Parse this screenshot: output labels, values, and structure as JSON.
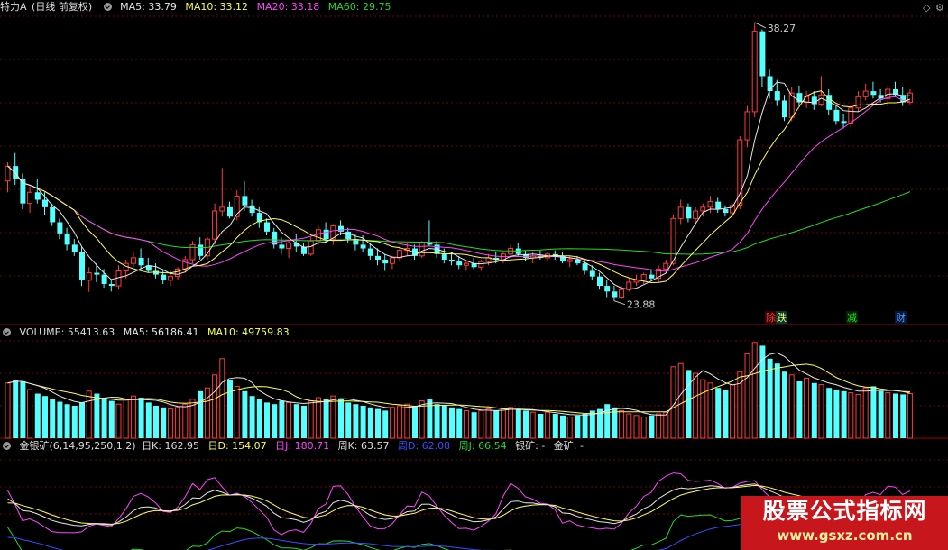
{
  "header": {
    "stock_name": "特力A",
    "period": "(日线 前复权)",
    "ma5": "MA5: 33.79",
    "ma10": "MA10: 33.12",
    "ma20": "MA20: 33.18",
    "ma60": "MA60: 29.75",
    "right_icons": [
      "diamond-icon",
      "gear-icon"
    ]
  },
  "volume_panel": {
    "label": "VOLUME: 55413.63",
    "ma5": "MA5: 56186.41",
    "ma10": "MA10: 49759.83"
  },
  "indicator_panel": {
    "name": "金银矿(6,14,95,250,1,2)",
    "day_k": "日K: 162.95",
    "day_d": "日D: 154.07",
    "day_j": "日J: 180.71",
    "week_k": "周K: 63.57",
    "week_d": "周D: 62.08",
    "week_j": "周J: 66.54",
    "silver": "银矿: -",
    "gold": "金矿: -"
  },
  "annotations": {
    "high_label": "38.27",
    "low_label": "23.88",
    "event_tags": [
      "除",
      "跌",
      "减",
      "财"
    ]
  },
  "watermark": {
    "title": "股票公式指标网",
    "url": "www.gsxz.com.cn"
  },
  "colors": {
    "up": "#ff3c3c",
    "down": "#54ffff",
    "ma5": "#e6e6e6",
    "ma10": "#ffff55",
    "ma20": "#ff44ff",
    "ma60": "#22dd22",
    "grid": "#7a0000"
  },
  "chart_data": {
    "type": "candlestick",
    "price_range": [
      23.88,
      38.27
    ],
    "candles": [
      [
        29.8,
        30.8,
        29.2,
        30.6
      ],
      [
        30.6,
        31.3,
        29.6,
        29.9
      ],
      [
        29.9,
        30.2,
        28.3,
        28.6
      ],
      [
        28.6,
        29.5,
        28.1,
        29.2
      ],
      [
        29.2,
        29.9,
        28.6,
        28.8
      ],
      [
        28.8,
        29.2,
        28.0,
        28.4
      ],
      [
        28.4,
        28.6,
        27.4,
        27.6
      ],
      [
        27.6,
        27.8,
        26.7,
        27.0
      ],
      [
        27.0,
        27.3,
        26.1,
        26.4
      ],
      [
        26.4,
        26.7,
        25.8,
        26.0
      ],
      [
        26.0,
        26.3,
        24.2,
        24.5
      ],
      [
        24.5,
        25.2,
        23.88,
        24.9
      ],
      [
        24.9,
        25.4,
        24.4,
        24.8
      ],
      [
        24.8,
        25.1,
        24.1,
        24.3
      ],
      [
        24.3,
        24.5,
        23.9,
        24.2
      ],
      [
        24.2,
        25.3,
        24.0,
        25.0
      ],
      [
        25.0,
        25.6,
        24.6,
        25.4
      ],
      [
        25.4,
        26.0,
        25.2,
        25.7
      ],
      [
        25.7,
        26.2,
        25.1,
        25.3
      ],
      [
        25.3,
        25.7,
        24.9,
        25.0
      ],
      [
        25.0,
        25.4,
        24.6,
        24.8
      ],
      [
        24.8,
        25.1,
        24.3,
        24.5
      ],
      [
        24.5,
        25.0,
        24.2,
        24.7
      ],
      [
        24.7,
        25.2,
        24.5,
        25.1
      ],
      [
        25.1,
        25.8,
        24.9,
        25.6
      ],
      [
        25.6,
        26.6,
        25.4,
        26.4
      ],
      [
        26.4,
        26.8,
        25.6,
        25.8
      ],
      [
        25.8,
        26.8,
        25.6,
        26.7
      ],
      [
        26.7,
        28.6,
        26.4,
        28.2
      ],
      [
        28.2,
        30.5,
        27.9,
        28.4
      ],
      [
        28.4,
        28.7,
        27.8,
        27.9
      ],
      [
        27.9,
        29.3,
        27.7,
        29.0
      ],
      [
        29.0,
        29.8,
        28.2,
        28.5
      ],
      [
        28.5,
        28.8,
        27.9,
        28.1
      ],
      [
        28.1,
        28.4,
        27.3,
        27.6
      ],
      [
        27.6,
        27.8,
        26.9,
        27.1
      ],
      [
        27.1,
        27.3,
        26.2,
        26.4
      ],
      [
        26.4,
        26.8,
        25.9,
        26.2
      ],
      [
        26.2,
        26.6,
        25.7,
        26.5
      ],
      [
        26.5,
        27.0,
        26.0,
        26.3
      ],
      [
        26.3,
        26.5,
        25.8,
        25.9
      ],
      [
        25.9,
        26.8,
        25.8,
        26.6
      ],
      [
        26.6,
        27.4,
        26.4,
        27.2
      ],
      [
        27.2,
        27.6,
        26.5,
        26.7
      ],
      [
        26.7,
        27.5,
        26.4,
        27.4
      ],
      [
        27.4,
        27.7,
        26.9,
        27.1
      ],
      [
        27.1,
        27.3,
        26.5,
        26.7
      ],
      [
        26.7,
        27.0,
        26.1,
        26.4
      ],
      [
        26.4,
        26.9,
        26.0,
        26.2
      ],
      [
        26.2,
        26.5,
        25.6,
        25.8
      ],
      [
        25.8,
        26.2,
        25.3,
        25.6
      ],
      [
        25.6,
        25.9,
        25.0,
        25.4
      ],
      [
        25.4,
        25.8,
        25.1,
        25.7
      ],
      [
        25.7,
        26.3,
        25.5,
        26.1
      ],
      [
        26.1,
        26.5,
        25.8,
        26.2
      ],
      [
        26.2,
        26.4,
        25.6,
        25.8
      ],
      [
        25.8,
        26.6,
        25.7,
        26.5
      ],
      [
        26.5,
        27.7,
        26.3,
        26.4
      ],
      [
        26.4,
        26.6,
        25.7,
        25.9
      ],
      [
        25.9,
        26.2,
        25.4,
        25.6
      ],
      [
        25.6,
        26.0,
        25.3,
        25.5
      ],
      [
        25.5,
        25.8,
        25.1,
        25.3
      ],
      [
        25.3,
        25.6,
        25.0,
        25.4
      ],
      [
        25.4,
        25.7,
        25.1,
        25.2
      ],
      [
        25.2,
        25.6,
        25.0,
        25.5
      ],
      [
        25.5,
        25.9,
        25.3,
        25.7
      ],
      [
        25.7,
        26.0,
        25.4,
        25.6
      ],
      [
        25.6,
        26.0,
        25.4,
        25.9
      ],
      [
        25.9,
        26.4,
        25.7,
        26.2
      ],
      [
        26.2,
        26.5,
        25.8,
        25.9
      ],
      [
        25.9,
        26.1,
        25.5,
        25.7
      ],
      [
        25.7,
        26.0,
        25.4,
        25.8
      ],
      [
        25.8,
        26.1,
        25.6,
        25.7
      ],
      [
        25.7,
        26.0,
        25.5,
        25.9
      ],
      [
        25.9,
        26.1,
        25.6,
        25.8
      ],
      [
        25.8,
        26.0,
        25.4,
        25.5
      ],
      [
        25.5,
        25.8,
        25.2,
        25.6
      ],
      [
        25.6,
        25.8,
        25.3,
        25.4
      ],
      [
        25.4,
        25.6,
        24.8,
        25.0
      ],
      [
        25.0,
        25.3,
        24.5,
        24.7
      ],
      [
        24.7,
        24.9,
        24.0,
        24.2
      ],
      [
        24.2,
        24.5,
        23.6,
        23.9
      ],
      [
        23.9,
        24.2,
        23.4,
        23.6
      ],
      [
        23.6,
        24.2,
        23.5,
        24.0
      ],
      [
        24.0,
        24.6,
        23.9,
        24.4
      ],
      [
        24.4,
        24.8,
        24.2,
        24.5
      ],
      [
        24.5,
        24.9,
        24.3,
        24.8
      ],
      [
        24.8,
        25.1,
        24.5,
        24.6
      ],
      [
        24.6,
        25.3,
        24.4,
        25.1
      ],
      [
        25.1,
        25.6,
        24.9,
        25.4
      ],
      [
        25.4,
        28.0,
        25.3,
        27.8
      ],
      [
        27.8,
        28.8,
        27.5,
        28.4
      ],
      [
        28.4,
        28.6,
        27.6,
        27.8
      ],
      [
        27.8,
        28.4,
        27.5,
        28.2
      ],
      [
        28.2,
        28.6,
        27.9,
        28.4
      ],
      [
        28.4,
        29.0,
        28.1,
        28.7
      ],
      [
        28.7,
        28.9,
        28.1,
        28.3
      ],
      [
        28.3,
        28.5,
        27.9,
        28.1
      ],
      [
        28.1,
        28.6,
        27.9,
        28.5
      ],
      [
        28.5,
        32.2,
        28.3,
        32.0
      ],
      [
        32.0,
        33.8,
        31.6,
        33.5
      ],
      [
        33.5,
        38.27,
        33.2,
        37.8
      ],
      [
        37.8,
        37.9,
        34.8,
        35.4
      ],
      [
        35.4,
        35.8,
        34.2,
        34.6
      ],
      [
        34.6,
        35.2,
        33.8,
        34.1
      ],
      [
        34.1,
        34.4,
        33.0,
        33.2
      ],
      [
        33.2,
        34.8,
        33.0,
        34.5
      ],
      [
        34.5,
        34.9,
        33.8,
        34.0
      ],
      [
        34.0,
        34.6,
        33.7,
        34.3
      ],
      [
        34.3,
        34.6,
        33.6,
        33.9
      ],
      [
        33.9,
        35.4,
        33.8,
        34.4
      ],
      [
        34.4,
        34.7,
        33.3,
        33.6
      ],
      [
        33.6,
        33.9,
        32.8,
        33.0
      ],
      [
        33.0,
        33.4,
        32.6,
        32.9
      ],
      [
        32.9,
        33.8,
        32.6,
        33.7
      ],
      [
        33.7,
        34.6,
        33.5,
        34.3
      ],
      [
        34.3,
        35.0,
        34.1,
        34.6
      ],
      [
        34.6,
        35.1,
        34.2,
        34.4
      ],
      [
        34.4,
        34.7,
        34.0,
        34.2
      ],
      [
        34.2,
        34.9,
        33.8,
        34.7
      ],
      [
        34.7,
        35.1,
        34.3,
        34.4
      ],
      [
        34.4,
        34.8,
        33.8,
        34.0
      ],
      [
        34.0,
        34.7,
        33.9,
        34.5
      ]
    ],
    "volume": [
      68,
      72,
      70,
      60,
      55,
      52,
      48,
      45,
      42,
      40,
      44,
      58,
      55,
      50,
      46,
      42,
      48,
      52,
      50,
      44,
      40,
      38,
      36,
      38,
      42,
      48,
      58,
      62,
      78,
      98,
      72,
      64,
      58,
      52,
      48,
      44,
      42,
      46,
      44,
      42,
      40,
      46,
      50,
      48,
      52,
      48,
      44,
      42,
      40,
      38,
      36,
      34,
      38,
      40,
      42,
      40,
      46,
      48,
      42,
      40,
      38,
      36,
      34,
      32,
      34,
      36,
      34,
      36,
      38,
      36,
      34,
      32,
      30,
      32,
      30,
      28,
      26,
      28,
      30,
      34,
      36,
      42,
      38,
      34,
      30,
      28,
      26,
      28,
      30,
      32,
      88,
      92,
      84,
      80,
      72,
      68,
      62,
      60,
      66,
      82,
      104,
      118,
      114,
      98,
      92,
      82,
      78,
      70,
      74,
      68,
      66,
      62,
      60,
      58,
      56,
      54,
      62,
      64,
      58,
      56,
      55,
      54,
      55
    ],
    "annotations": {
      "high": 38.27,
      "low": 23.88
    }
  }
}
